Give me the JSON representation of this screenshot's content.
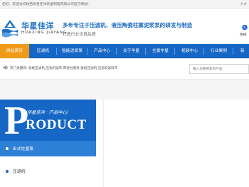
{
  "topbar": {
    "welcome": "您好，欢迎访问陕西华星佳洋装备制造有限公司官方网站!",
    "right_link": "人才"
  },
  "header": {
    "logo_cn": "华星佳洋",
    "logo_en": "HUAXING JIAYANG",
    "slogan_main": "多年专注于压滤机、液压陶瓷柱塞泥浆泵的研发与制造",
    "slogan_sub": "打造行业优良品牌",
    "hotline_label": "热线"
  },
  "nav": {
    "items": [
      "网站首页",
      "压滤机",
      "智能泥浆泵",
      "产品中心",
      "关于华星",
      "全景华星",
      "视频中心",
      "行业案例",
      "新"
    ]
  },
  "keywords": {
    "label": "热门关键词:",
    "text": "板框压滤机,压滤机滤布,陶瓷柱塞泵,板框压滤机,压滤机滤料布",
    "search_placeholder": "输入您要搜索的产品"
  },
  "product_banner": {
    "letter": "P",
    "cn": "/华星佳洋 · 产品中心/",
    "en": "RODUCT"
  },
  "side_menu": {
    "items": [
      "卧式柱塞泵",
      "压滤机"
    ]
  },
  "colors": {
    "nav_blue": "#1667c5",
    "nav_active_orange": "#f09a1a",
    "slogan_blue": "#1f6dc0"
  }
}
